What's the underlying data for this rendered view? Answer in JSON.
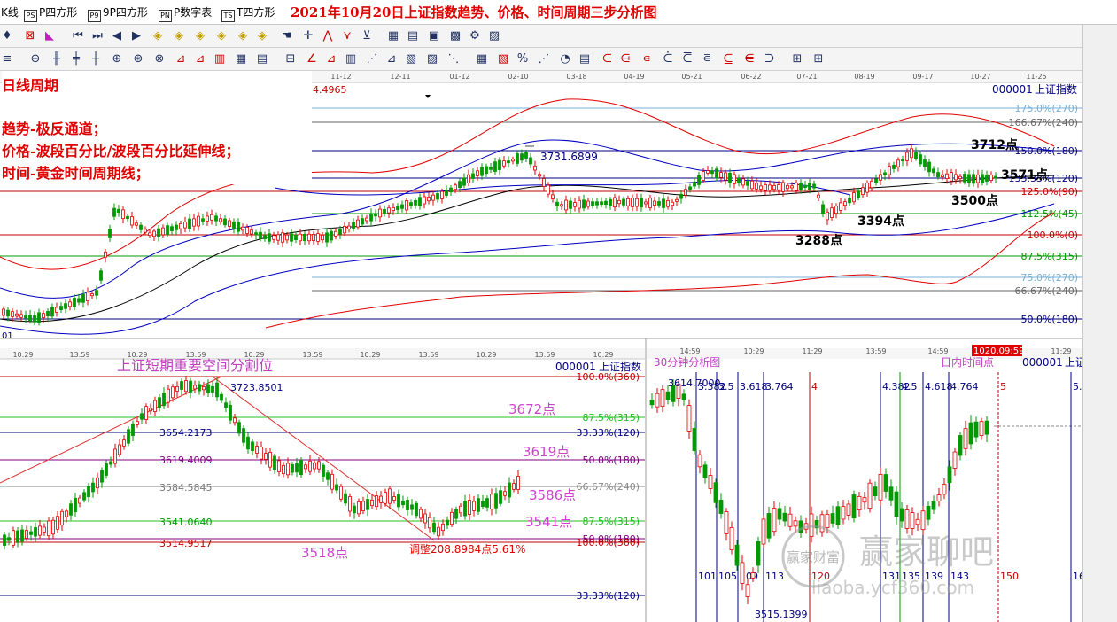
{
  "tabs": [
    {
      "icon": "",
      "label": "K线"
    },
    {
      "icon": "PS",
      "label": "P四方形"
    },
    {
      "icon": "P9",
      "label": "9P四方形"
    },
    {
      "icon": "PN",
      "label": "P数字表"
    },
    {
      "icon": "TS",
      "label": "T四方形"
    }
  ],
  "title": "2021年10月20日上证指数趋势、价格、时间周期三步分析图",
  "annotations": {
    "cycle": "日线周期",
    "trend": "趋势-极反通道；",
    "price": "价格-波段百分比/波段百分比延伸线；",
    "time": "时间-黄金时间周期线；"
  },
  "colors": {
    "up": "#e00000",
    "down": "#009900",
    "purple": "#d020c0",
    "navy": "#000080",
    "red": "#e00000",
    "green": "#20c020",
    "blue": "#0000c0"
  },
  "top_chart": {
    "dates": [
      "11-12",
      "12-11",
      "01-12",
      "02-10",
      "03-18",
      "04-19",
      "05-21",
      "06-22",
      "07-21",
      "08-19",
      "09-17",
      "10-27",
      "11-25"
    ],
    "scale_value": "4.4965",
    "code": "000001",
    "name": "上证指数",
    "bottom_left": "01",
    "levels": [
      {
        "label": "175.0%(270)",
        "color": "#78b0d8"
      },
      {
        "label": "166.67%(240)",
        "color": "#666666"
      },
      {
        "label": "150.0%(180)",
        "color": "#000080"
      },
      {
        "label": "133.33%(120)",
        "color": "#000080"
      },
      {
        "label": "125.0%(90)",
        "color": "#c00000"
      },
      {
        "label": "112.5%(45)",
        "color": "#009900"
      },
      {
        "label": "100.0%(0)",
        "color": "#c00000"
      },
      {
        "label": "87.5%(315)",
        "color": "#009900"
      },
      {
        "label": "75.0%(270)",
        "color": "#78b0d8"
      },
      {
        "label": "66.67%(240)",
        "color": "#666666"
      },
      {
        "label": "50.0%(180)",
        "color": "#000080"
      }
    ],
    "price_labels": [
      "3731.6899",
      "3712点",
      "3571点",
      "3500点",
      "3394点",
      "3288点"
    ]
  },
  "bottom_left_chart": {
    "times": [
      "10:29",
      "13:59",
      "10:29",
      "13:59",
      "10:29",
      "13:59",
      "10:29",
      "13:59",
      "10:29",
      "13:59",
      "10:29"
    ],
    "code": "000001",
    "name": "上证指数",
    "heading": "上证短期重要空间分割位",
    "levels": [
      {
        "label": "100.0%(360)",
        "color": "#c00000"
      },
      {
        "label": "87.5%(315)",
        "color": "#20c020"
      },
      {
        "label": "33.33%(120)",
        "color": "#000080"
      },
      {
        "label": "50.0%(180)",
        "color": "#800080"
      },
      {
        "label": "66.67%(240)",
        "color": "#888888"
      },
      {
        "label": "87.5%(315)",
        "color": "#20c020"
      },
      {
        "label": "50.0%(180)",
        "color": "#800080"
      },
      {
        "label": "100.0%(360)",
        "color": "#c00000"
      },
      {
        "label": "33.33%(120)",
        "color": "#000080"
      }
    ],
    "left_values": [
      "3654.2173",
      "3619.4009",
      "3584.5845",
      "3541.0640",
      "3514.9517"
    ],
    "points": [
      "3672点",
      "3619点",
      "3586点",
      "3541点",
      "3518点"
    ],
    "high_label": "3723.8501",
    "adjust": "调整208.8984点5.61%"
  },
  "bottom_right_chart": {
    "times": [
      "14:59",
      "10:29",
      "11:29",
      "13:59",
      "14:59",
      "11:29"
    ],
    "date_badge": "1020.09:59",
    "heading": "30分钟分析图",
    "heading2": "日内时间点",
    "code": "000001",
    "name": "上证",
    "high": "3614.7000",
    "low": "3515.1399",
    "top_ratios": [
      "3.382",
      "3.5",
      "3.618",
      "3.764",
      "4",
      "4.382",
      "4.5",
      "4.618",
      "4.764",
      "5",
      "5."
    ],
    "bottom_counts": [
      "101",
      "105",
      "109",
      "113",
      "120",
      "131",
      "135",
      "139",
      "143",
      "150",
      "16"
    ]
  },
  "watermark": {
    "brand": "赢家聊吧",
    "url": "liaoba.ycf360.com",
    "seal": "赢家财富"
  }
}
